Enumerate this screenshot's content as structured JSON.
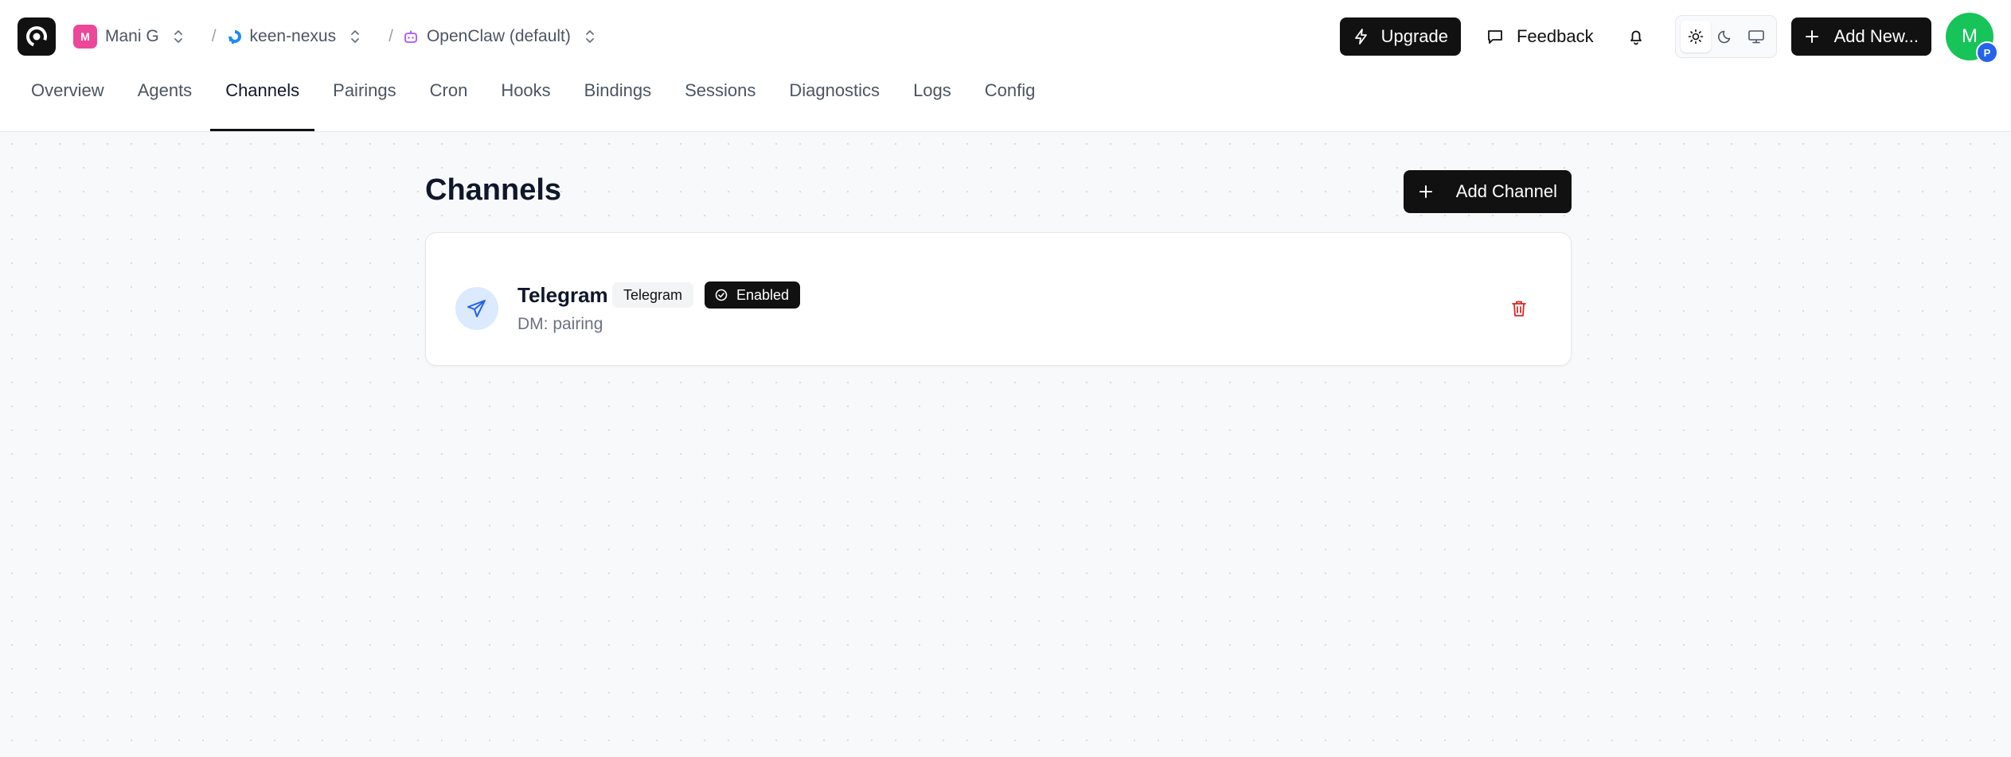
{
  "header": {
    "org": {
      "initial": "M",
      "name": "Mani G",
      "color": "#ec4899"
    },
    "project": {
      "name": "keen-nexus"
    },
    "agent": {
      "name": "OpenClaw (default)"
    },
    "separator": "/",
    "upgrade_label": "Upgrade",
    "feedback_label": "Feedback",
    "add_new_label": "Add New...",
    "theme_active": "light",
    "user": {
      "initial": "M",
      "badge": "P",
      "color": "#16c45a"
    }
  },
  "tabs": [
    {
      "label": "Overview"
    },
    {
      "label": "Agents"
    },
    {
      "label": "Channels",
      "active": true
    },
    {
      "label": "Pairings"
    },
    {
      "label": "Cron"
    },
    {
      "label": "Hooks"
    },
    {
      "label": "Bindings"
    },
    {
      "label": "Sessions"
    },
    {
      "label": "Diagnostics"
    },
    {
      "label": "Logs"
    },
    {
      "label": "Config"
    }
  ],
  "main": {
    "title": "Channels",
    "add_button_label": "Add Channel",
    "channels": [
      {
        "name": "Telegram",
        "tag": "Telegram",
        "status": "Enabled",
        "detail": "DM: pairing",
        "icon": "send-icon"
      }
    ]
  },
  "colors": {
    "accent_dark": "#111111",
    "danger": "#dc2626",
    "channel_icon": "#2563eb",
    "agent_icon": "#a855f7"
  }
}
